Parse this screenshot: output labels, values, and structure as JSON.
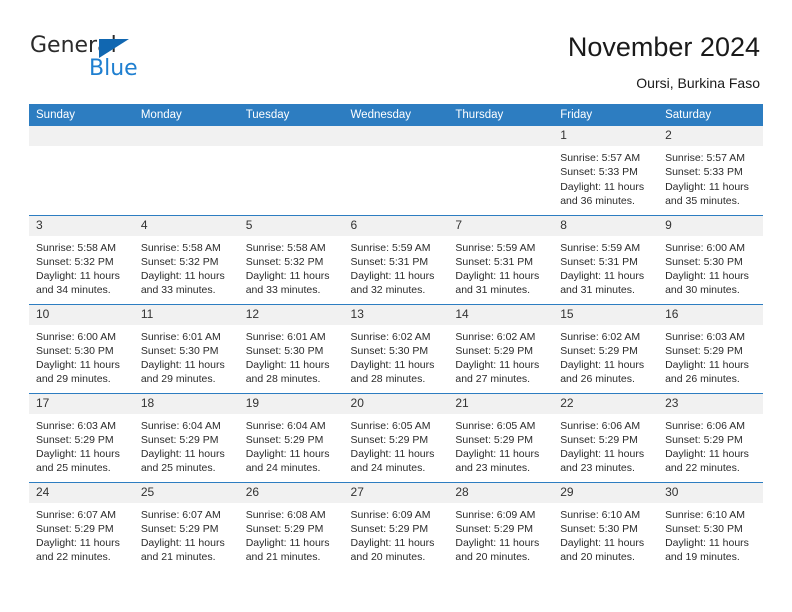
{
  "brand": {
    "name_part1": "General",
    "name_part2": "Blue",
    "accent_color": "#1167b1",
    "secondary_color": "#1f7fd0",
    "logo_icon": "triangle-flag-icon"
  },
  "header": {
    "title": "November 2024",
    "subtitle": "Oursi, Burkina Faso"
  },
  "calendar": {
    "header_color": "#2d7dc1",
    "daynum_band_color": "#f1f1f1",
    "weekdays": [
      "Sunday",
      "Monday",
      "Tuesday",
      "Wednesday",
      "Thursday",
      "Friday",
      "Saturday"
    ],
    "labels": {
      "sunrise": "Sunrise:",
      "sunset": "Sunset:",
      "daylight": "Daylight:"
    },
    "weeks": [
      [
        {
          "day": "",
          "empty": true
        },
        {
          "day": "",
          "empty": true
        },
        {
          "day": "",
          "empty": true
        },
        {
          "day": "",
          "empty": true
        },
        {
          "day": "",
          "empty": true
        },
        {
          "day": "1",
          "sunrise": "Sunrise: 5:57 AM",
          "sunset": "Sunset: 5:33 PM",
          "daylight_1": "Daylight: 11 hours",
          "daylight_2": "and 36 minutes."
        },
        {
          "day": "2",
          "sunrise": "Sunrise: 5:57 AM",
          "sunset": "Sunset: 5:33 PM",
          "daylight_1": "Daylight: 11 hours",
          "daylight_2": "and 35 minutes."
        }
      ],
      [
        {
          "day": "3",
          "sunrise": "Sunrise: 5:58 AM",
          "sunset": "Sunset: 5:32 PM",
          "daylight_1": "Daylight: 11 hours",
          "daylight_2": "and 34 minutes."
        },
        {
          "day": "4",
          "sunrise": "Sunrise: 5:58 AM",
          "sunset": "Sunset: 5:32 PM",
          "daylight_1": "Daylight: 11 hours",
          "daylight_2": "and 33 minutes."
        },
        {
          "day": "5",
          "sunrise": "Sunrise: 5:58 AM",
          "sunset": "Sunset: 5:32 PM",
          "daylight_1": "Daylight: 11 hours",
          "daylight_2": "and 33 minutes."
        },
        {
          "day": "6",
          "sunrise": "Sunrise: 5:59 AM",
          "sunset": "Sunset: 5:31 PM",
          "daylight_1": "Daylight: 11 hours",
          "daylight_2": "and 32 minutes."
        },
        {
          "day": "7",
          "sunrise": "Sunrise: 5:59 AM",
          "sunset": "Sunset: 5:31 PM",
          "daylight_1": "Daylight: 11 hours",
          "daylight_2": "and 31 minutes."
        },
        {
          "day": "8",
          "sunrise": "Sunrise: 5:59 AM",
          "sunset": "Sunset: 5:31 PM",
          "daylight_1": "Daylight: 11 hours",
          "daylight_2": "and 31 minutes."
        },
        {
          "day": "9",
          "sunrise": "Sunrise: 6:00 AM",
          "sunset": "Sunset: 5:30 PM",
          "daylight_1": "Daylight: 11 hours",
          "daylight_2": "and 30 minutes."
        }
      ],
      [
        {
          "day": "10",
          "sunrise": "Sunrise: 6:00 AM",
          "sunset": "Sunset: 5:30 PM",
          "daylight_1": "Daylight: 11 hours",
          "daylight_2": "and 29 minutes."
        },
        {
          "day": "11",
          "sunrise": "Sunrise: 6:01 AM",
          "sunset": "Sunset: 5:30 PM",
          "daylight_1": "Daylight: 11 hours",
          "daylight_2": "and 29 minutes."
        },
        {
          "day": "12",
          "sunrise": "Sunrise: 6:01 AM",
          "sunset": "Sunset: 5:30 PM",
          "daylight_1": "Daylight: 11 hours",
          "daylight_2": "and 28 minutes."
        },
        {
          "day": "13",
          "sunrise": "Sunrise: 6:02 AM",
          "sunset": "Sunset: 5:30 PM",
          "daylight_1": "Daylight: 11 hours",
          "daylight_2": "and 28 minutes."
        },
        {
          "day": "14",
          "sunrise": "Sunrise: 6:02 AM",
          "sunset": "Sunset: 5:29 PM",
          "daylight_1": "Daylight: 11 hours",
          "daylight_2": "and 27 minutes."
        },
        {
          "day": "15",
          "sunrise": "Sunrise: 6:02 AM",
          "sunset": "Sunset: 5:29 PM",
          "daylight_1": "Daylight: 11 hours",
          "daylight_2": "and 26 minutes."
        },
        {
          "day": "16",
          "sunrise": "Sunrise: 6:03 AM",
          "sunset": "Sunset: 5:29 PM",
          "daylight_1": "Daylight: 11 hours",
          "daylight_2": "and 26 minutes."
        }
      ],
      [
        {
          "day": "17",
          "sunrise": "Sunrise: 6:03 AM",
          "sunset": "Sunset: 5:29 PM",
          "daylight_1": "Daylight: 11 hours",
          "daylight_2": "and 25 minutes."
        },
        {
          "day": "18",
          "sunrise": "Sunrise: 6:04 AM",
          "sunset": "Sunset: 5:29 PM",
          "daylight_1": "Daylight: 11 hours",
          "daylight_2": "and 25 minutes."
        },
        {
          "day": "19",
          "sunrise": "Sunrise: 6:04 AM",
          "sunset": "Sunset: 5:29 PM",
          "daylight_1": "Daylight: 11 hours",
          "daylight_2": "and 24 minutes."
        },
        {
          "day": "20",
          "sunrise": "Sunrise: 6:05 AM",
          "sunset": "Sunset: 5:29 PM",
          "daylight_1": "Daylight: 11 hours",
          "daylight_2": "and 24 minutes."
        },
        {
          "day": "21",
          "sunrise": "Sunrise: 6:05 AM",
          "sunset": "Sunset: 5:29 PM",
          "daylight_1": "Daylight: 11 hours",
          "daylight_2": "and 23 minutes."
        },
        {
          "day": "22",
          "sunrise": "Sunrise: 6:06 AM",
          "sunset": "Sunset: 5:29 PM",
          "daylight_1": "Daylight: 11 hours",
          "daylight_2": "and 23 minutes."
        },
        {
          "day": "23",
          "sunrise": "Sunrise: 6:06 AM",
          "sunset": "Sunset: 5:29 PM",
          "daylight_1": "Daylight: 11 hours",
          "daylight_2": "and 22 minutes."
        }
      ],
      [
        {
          "day": "24",
          "sunrise": "Sunrise: 6:07 AM",
          "sunset": "Sunset: 5:29 PM",
          "daylight_1": "Daylight: 11 hours",
          "daylight_2": "and 22 minutes."
        },
        {
          "day": "25",
          "sunrise": "Sunrise: 6:07 AM",
          "sunset": "Sunset: 5:29 PM",
          "daylight_1": "Daylight: 11 hours",
          "daylight_2": "and 21 minutes."
        },
        {
          "day": "26",
          "sunrise": "Sunrise: 6:08 AM",
          "sunset": "Sunset: 5:29 PM",
          "daylight_1": "Daylight: 11 hours",
          "daylight_2": "and 21 minutes."
        },
        {
          "day": "27",
          "sunrise": "Sunrise: 6:09 AM",
          "sunset": "Sunset: 5:29 PM",
          "daylight_1": "Daylight: 11 hours",
          "daylight_2": "and 20 minutes."
        },
        {
          "day": "28",
          "sunrise": "Sunrise: 6:09 AM",
          "sunset": "Sunset: 5:29 PM",
          "daylight_1": "Daylight: 11 hours",
          "daylight_2": "and 20 minutes."
        },
        {
          "day": "29",
          "sunrise": "Sunrise: 6:10 AM",
          "sunset": "Sunset: 5:30 PM",
          "daylight_1": "Daylight: 11 hours",
          "daylight_2": "and 20 minutes."
        },
        {
          "day": "30",
          "sunrise": "Sunrise: 6:10 AM",
          "sunset": "Sunset: 5:30 PM",
          "daylight_1": "Daylight: 11 hours",
          "daylight_2": "and 19 minutes."
        }
      ]
    ]
  }
}
